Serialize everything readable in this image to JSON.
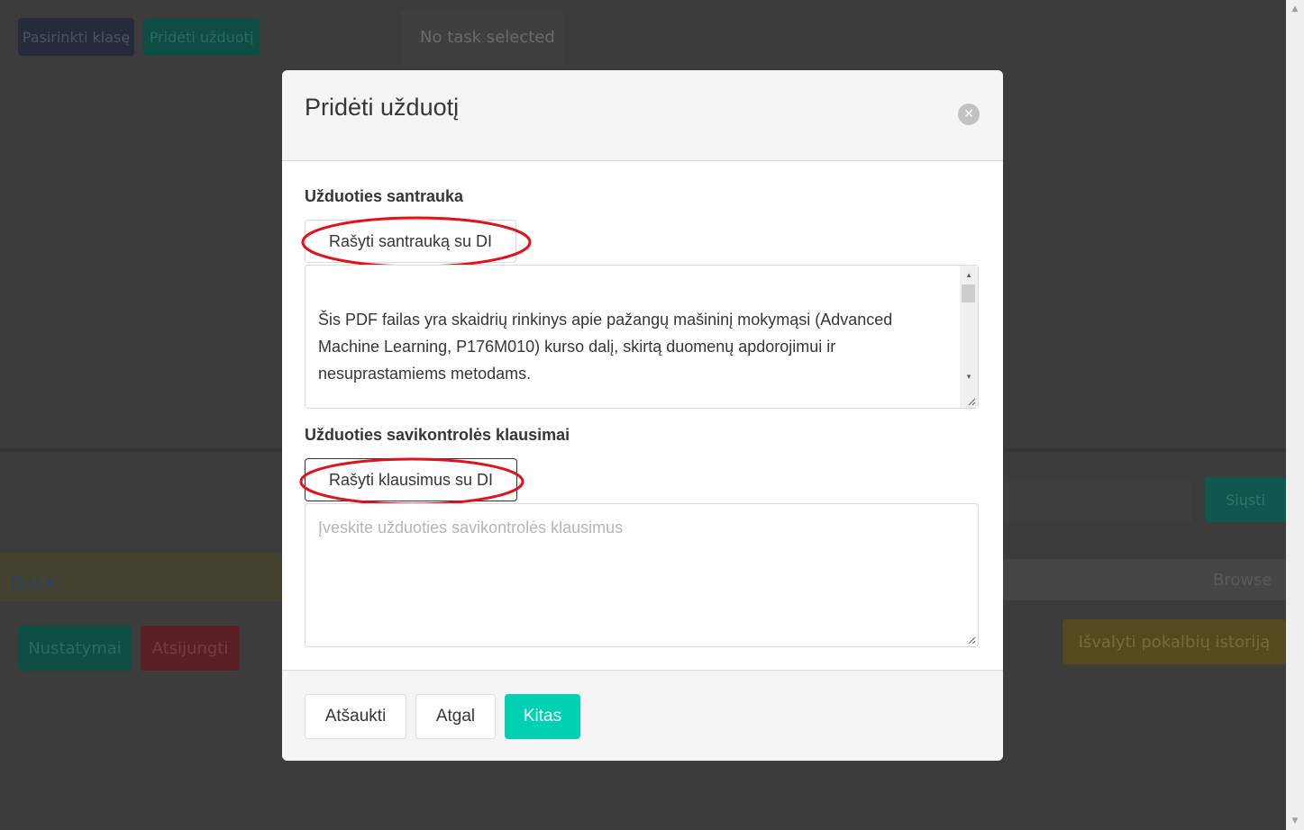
{
  "background": {
    "buttons": {
      "select_class": "Pasirinkti klasę",
      "add_task": "Pridėti užduotį",
      "send": "Siųsti",
      "settings": "Nustatymai",
      "logout": "Atsijungti",
      "clear_history": "Išvalyti pokalbių istoriją"
    },
    "no_task_text": "No task selected",
    "faq_link": "D.U.K.",
    "browse_label": "Browse"
  },
  "modal": {
    "title": "Pridėti užduotį",
    "summary": {
      "label": "Užduoties santrauka",
      "ai_button": "Rašyti santrauką su DI",
      "text": "Šis PDF failas yra skaidrių rinkinys apie pažangų mašininį mokymąsi (Advanced Machine Learning, P176M010) kurso dalį, skirtą duomenų apdorojimui ir nesuprastamiems metodams."
    },
    "questions": {
      "label": "Užduoties savikontrolės klausimai",
      "ai_button": "Rašyti klausimus su DI",
      "placeholder": "Įveskite užduoties savikontrolės klausimus"
    },
    "footer": {
      "cancel": "Atšaukti",
      "back": "Atgal",
      "next": "Kitas"
    }
  },
  "colors": {
    "primary": "#00d1b2",
    "annotation": "#e0121b",
    "overlay": "#3b3b3b"
  }
}
